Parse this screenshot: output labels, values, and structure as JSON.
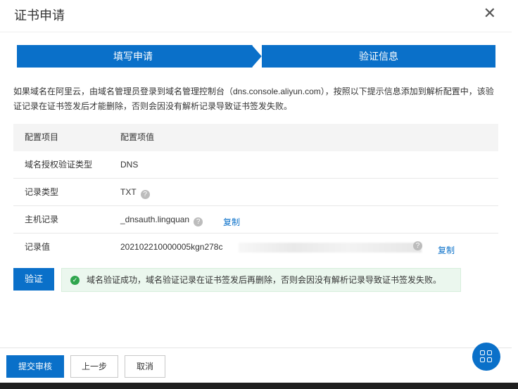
{
  "dialog": {
    "title": "证书申请"
  },
  "steps": [
    {
      "label": "填写申请"
    },
    {
      "label": "验证信息"
    }
  ],
  "description": "如果域名在阿里云，由域名管理员登录到域名管理控制台（dns.console.aliyun.com），按照以下提示信息添加到解析配置中，该验证记录在证书签发后才能删除，否则会因没有解析记录导致证书签发失败。",
  "table": {
    "headers": [
      "配置项目",
      "配置项值"
    ],
    "rows": [
      {
        "key": "域名授权验证类型",
        "value": "DNS"
      },
      {
        "key": "记录类型",
        "value": "TXT"
      },
      {
        "key": "主机记录",
        "value": "_dnsauth.lingquan",
        "copy": "复制"
      },
      {
        "key": "记录值",
        "value": "202102210000005kgn278c",
        "copy": "复制"
      }
    ]
  },
  "verify_button": "验证",
  "success_message": "域名验证成功，域名验证记录在证书签发后再删除，否则会因没有解析记录导致证书签发失败。",
  "footer": {
    "submit": "提交审核",
    "prev": "上一步",
    "cancel": "取消"
  },
  "colors": {
    "primary": "#0a70c9",
    "success_bg": "#ebf7ee",
    "success_icon": "#2fa54d"
  }
}
